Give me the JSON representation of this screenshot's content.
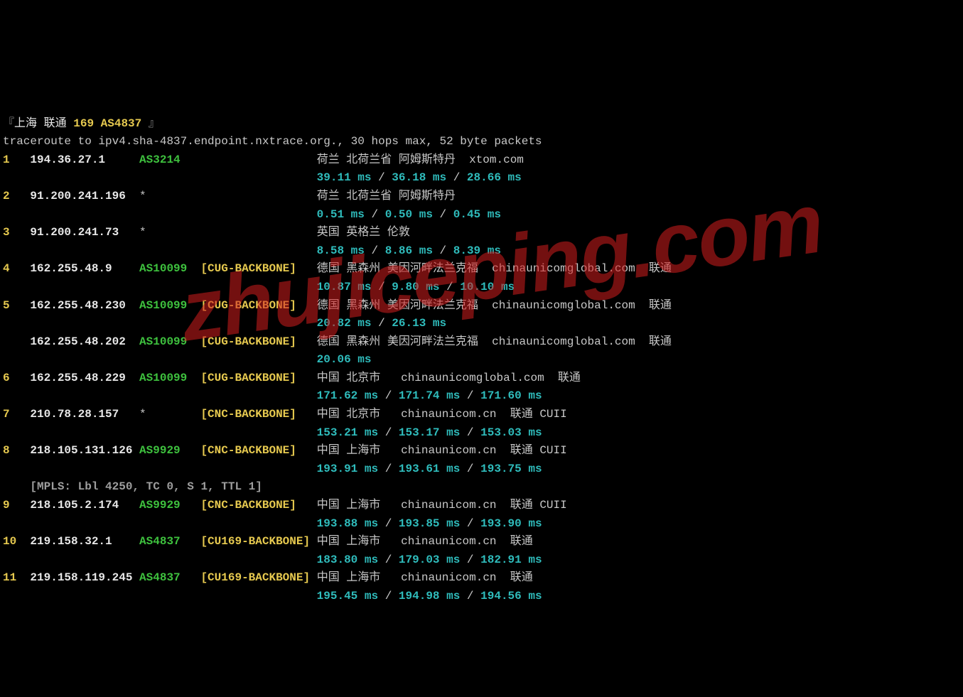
{
  "title": {
    "open": "『",
    "location": "上海 联通",
    "asn": "169 AS4837",
    "close": " 』"
  },
  "header": "traceroute to ipv4.sha-4837.endpoint.nxtrace.org., 30 hops max, 52 byte packets",
  "watermark": "zhujiceping.com",
  "hops": [
    {
      "num": "1",
      "ip": "194.36.27.1",
      "asn": "AS3214",
      "bracket": "",
      "geo": "荷兰 北荷兰省 阿姆斯特丹  xtom.com",
      "lat": [
        "39.11 ms",
        "36.18 ms",
        "28.66 ms"
      ]
    },
    {
      "num": "2",
      "ip": "91.200.241.196",
      "asn": "*",
      "bracket": "",
      "geo": "荷兰 北荷兰省 阿姆斯特丹",
      "lat": [
        "0.51 ms",
        "0.50 ms",
        "0.45 ms"
      ]
    },
    {
      "num": "3",
      "ip": "91.200.241.73",
      "asn": "*",
      "bracket": "",
      "geo": "英国 英格兰 伦敦",
      "lat": [
        "8.58 ms",
        "8.86 ms",
        "8.39 ms"
      ]
    },
    {
      "num": "4",
      "ip": "162.255.48.9",
      "asn": "AS10099",
      "bracket": "[CUG-BACKBONE]",
      "geo": "德国 黑森州 美因河畔法兰克福  chinaunicomglobal.com  联通",
      "lat": [
        "10.87 ms",
        "9.80 ms",
        "10.10 ms"
      ]
    },
    {
      "num": "5",
      "ip": "162.255.48.230",
      "asn": "AS10099",
      "bracket": "[CUG-BACKBONE]",
      "geo": "德国 黑森州 美因河畔法兰克福  chinaunicomglobal.com  联通",
      "lat": [
        "20.82 ms",
        "26.13 ms"
      ]
    },
    {
      "num": "",
      "ip": "162.255.48.202",
      "asn": "AS10099",
      "bracket": "[CUG-BACKBONE]",
      "geo": "德国 黑森州 美因河畔法兰克福  chinaunicomglobal.com  联通",
      "lat": [
        "20.06 ms"
      ]
    },
    {
      "num": "6",
      "ip": "162.255.48.229",
      "asn": "AS10099",
      "bracket": "[CUG-BACKBONE]",
      "geo": "中国 北京市   chinaunicomglobal.com  联通",
      "lat": [
        "171.62 ms",
        "171.74 ms",
        "171.60 ms"
      ]
    },
    {
      "num": "7",
      "ip": "210.78.28.157",
      "asn": "*",
      "bracket": "[CNC-BACKBONE]",
      "geo": "中国 北京市   chinaunicom.cn  联通 CUII",
      "lat": [
        "153.21 ms",
        "153.17 ms",
        "153.03 ms"
      ]
    },
    {
      "num": "8",
      "ip": "218.105.131.126",
      "asn": "AS9929",
      "bracket": "[CNC-BACKBONE]",
      "geo": "中国 上海市   chinaunicom.cn  联通 CUII",
      "lat": [
        "193.91 ms",
        "193.61 ms",
        "193.75 ms"
      ],
      "mpls": "[MPLS: Lbl 4250, TC 0, S 1, TTL 1]"
    },
    {
      "num": "9",
      "ip": "218.105.2.174",
      "asn": "AS9929",
      "bracket": "[CNC-BACKBONE]",
      "geo": "中国 上海市   chinaunicom.cn  联通 CUII",
      "lat": [
        "193.88 ms",
        "193.85 ms",
        "193.90 ms"
      ]
    },
    {
      "num": "10",
      "ip": "219.158.32.1",
      "asn": "AS4837",
      "bracket": "[CU169-BACKBONE]",
      "geo": "中国 上海市   chinaunicom.cn  联通",
      "lat": [
        "183.80 ms",
        "179.03 ms",
        "182.91 ms"
      ]
    },
    {
      "num": "11",
      "ip": "219.158.119.245",
      "asn": "AS4837",
      "bracket": "[CU169-BACKBONE]",
      "geo": "中国 上海市   chinaunicom.cn  联通",
      "lat": [
        "195.45 ms",
        "194.98 ms",
        "194.56 ms"
      ]
    }
  ]
}
